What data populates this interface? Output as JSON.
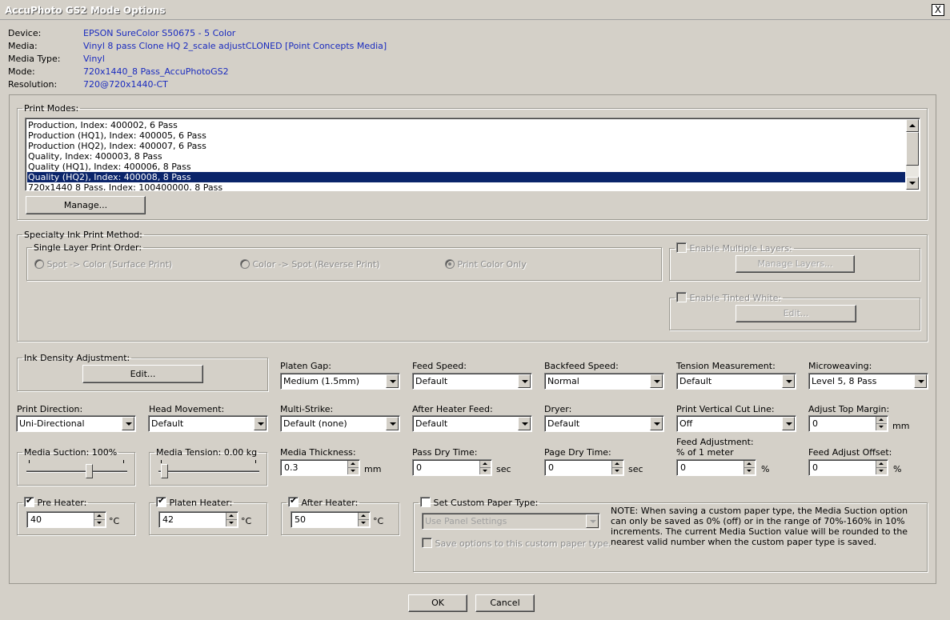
{
  "window": {
    "title": "AccuPhoto GS2 Mode Options",
    "close_label": "X"
  },
  "info": [
    {
      "label": "Device:",
      "value": "EPSON SureColor S50675 - 5 Color"
    },
    {
      "label": "Media:",
      "value": "Vinyl 8 pass Clone HQ 2_scale adjustCLONED [Point Concepts Media]"
    },
    {
      "label": "Media Type:",
      "value": "Vinyl"
    },
    {
      "label": "Mode:",
      "value": "720x1440_8 Pass_AccuPhotoGS2"
    },
    {
      "label": "Resolution:",
      "value": "720@720x1440-CT"
    }
  ],
  "print_modes": {
    "legend": "Print Modes:",
    "items": [
      "Production, Index: 400002, 6 Pass",
      "Production (HQ1), Index: 400005, 6 Pass",
      "Production (HQ2), Index: 400007, 6 Pass",
      "Quality, Index: 400003, 8 Pass",
      "Quality (HQ1), Index: 400006, 8 Pass",
      "Quality (HQ2), Index: 400008, 8 Pass",
      "720x1440 8 Pass, Index: 100400000, 8 Pass"
    ],
    "selected_index": 5,
    "manage_label": "Manage..."
  },
  "specialty": {
    "legend": "Specialty Ink Print Method:",
    "single_layer_legend": "Single Layer Print Order:",
    "options": [
      "Spot -> Color (Surface Print)",
      "Color -> Spot (Reverse Print)",
      "Print Color Only"
    ],
    "selected_option": 2,
    "enable_multiple_layers": "Enable Multiple Layers:",
    "manage_layers": "Manage Layers...",
    "enable_tinted_white": "Enable Tinted White:",
    "edit_label": "Edit..."
  },
  "ink_density": {
    "legend": "Ink Density Adjustment:",
    "edit_label": "Edit..."
  },
  "dropdowns_row1": [
    {
      "label": "Platen Gap:",
      "value": "Medium (1.5mm)"
    },
    {
      "label": "Feed Speed:",
      "value": "Default"
    },
    {
      "label": "Backfeed Speed:",
      "value": "Normal"
    },
    {
      "label": "Tension Measurement:",
      "value": "Default"
    },
    {
      "label": "Microweaving:",
      "value": "Level 5, 8 Pass"
    }
  ],
  "dropdowns_row2": [
    {
      "label": "Print Direction:",
      "value": "Uni-Directional"
    },
    {
      "label": "Head Movement:",
      "value": "Default"
    },
    {
      "label": "Multi-Strike:",
      "value": "Default (none)"
    },
    {
      "label": "After Heater Feed:",
      "value": "Default"
    },
    {
      "label": "Dryer:",
      "value": "Default"
    },
    {
      "label": "Print Vertical Cut Line:",
      "value": "Off"
    }
  ],
  "adjust_top_margin": {
    "label": "Adjust Top Margin:",
    "value": "0",
    "unit": "mm"
  },
  "media_suction": {
    "legend": "Media Suction: 100%",
    "level": 0.6
  },
  "media_tension": {
    "legend": "Media Tension: 0.00 kg",
    "level": 0.0
  },
  "media_thickness": {
    "label": "Media Thickness:",
    "value": "0.3",
    "unit": "mm"
  },
  "pass_dry_time": {
    "label": "Pass Dry Time:",
    "value": "0",
    "unit": "sec"
  },
  "page_dry_time": {
    "label": "Page Dry Time:",
    "value": "0",
    "unit": "sec"
  },
  "feed_adjustment": {
    "label1": "Feed Adjustment:",
    "label2": "% of 1 meter",
    "value": "0",
    "unit": "%"
  },
  "feed_adjust_offset": {
    "label": "Feed Adjust Offset:",
    "value": "0",
    "unit": "%"
  },
  "heaters": [
    {
      "label": "Pre Heater:",
      "value": "40",
      "unit": "°C",
      "checked": true
    },
    {
      "label": "Platen Heater:",
      "value": "42",
      "unit": "°C",
      "checked": true
    },
    {
      "label": "After Heater:",
      "value": "50",
      "unit": "°C",
      "checked": true
    }
  ],
  "custom_paper": {
    "legend": "Set Custom Paper Type:",
    "select_value": "Use Panel Settings",
    "save_options": "Save options to this custom paper type.",
    "note": "NOTE: When saving a custom paper type, the Media Suction option can only be saved as 0% (off) or in the range of 70%-160% in 10% increments. The current Media Suction value will be rounded to the nearest valid number when the custom paper type is saved."
  },
  "buttons": {
    "ok": "OK",
    "cancel": "Cancel"
  }
}
